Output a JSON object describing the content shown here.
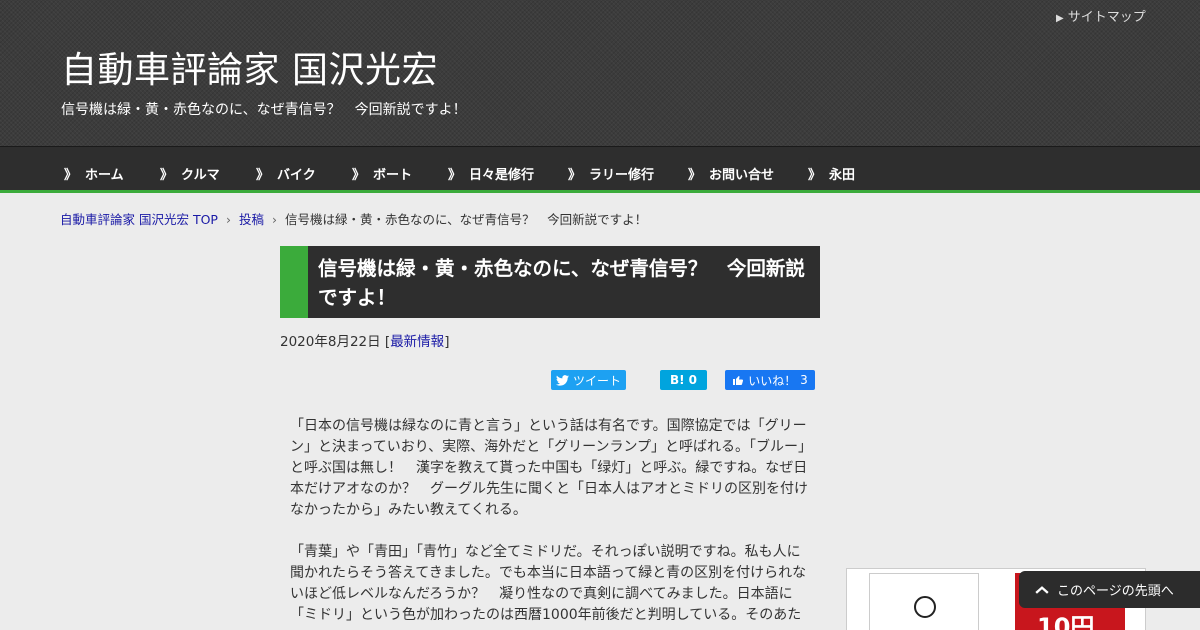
{
  "header": {
    "sitemap_label": "サイトマップ",
    "site_title": "自動車評論家 国沢光宏",
    "site_description": "信号機は緑・黄・赤色なのに、なぜ青信号？　今回新説ですよ！"
  },
  "nav": {
    "items": [
      {
        "label": "ホーム"
      },
      {
        "label": "クルマ"
      },
      {
        "label": "バイク"
      },
      {
        "label": "ボート"
      },
      {
        "label": "日々是修行"
      },
      {
        "label": "ラリー修行"
      },
      {
        "label": "お問い合せ"
      },
      {
        "label": "永田"
      }
    ]
  },
  "breadcrumb": {
    "home": "自動車評論家 国沢光宏 TOP",
    "category": "投稿",
    "current": "信号機は緑・黄・赤色なのに、なぜ青信号？　今回新説ですよ！"
  },
  "post": {
    "title": "信号機は緑・黄・赤色なのに、なぜ青信号？　今回新説ですよ！",
    "date": "2020年8月22日",
    "category": "最新情報",
    "paragraphs": [
      "「日本の信号機は緑なのに青と言う」という話は有名です。国際協定では「グリーン」と決まっていおり、実際、海外だと「グリーンランプ」と呼ばれる。「ブルー」と呼ぶ国は無し！　漢字を教えて貰った中国も「绿灯」と呼ぶ。緑ですね。なぜ日本だけアオなのか？　グーグル先生に聞くと「日本人はアオとミドリの区別を付けなかったから」みたい教えてくれる。",
      "「青葉」や「青田」「青竹」など全てミドリだ。それっぽい説明ですね。私も人に聞かれたらそう答えてきました。でも本当に日本語って緑と青の区別を付けられないほど低レベルなんだろうか？　凝り性なので真剣に調べてみました。日本語に「ミドリ」という色が加わったのは西暦1000年前後だと判明している。そのあた"
    ]
  },
  "share": {
    "tweet_label": "ツイート",
    "hatena_icon": "B!",
    "hatena_count": "0",
    "like_label": "いいね！",
    "like_count": "3"
  },
  "sidebar": {
    "ad_price": "10円"
  },
  "back_to_top_label": "このページの先頭へ",
  "colors": {
    "accent_green": "#3bab3b",
    "header_bg": "#3c3c3c",
    "nav_bg": "#2e2e2e",
    "link_blue": "#1a1aa6"
  }
}
